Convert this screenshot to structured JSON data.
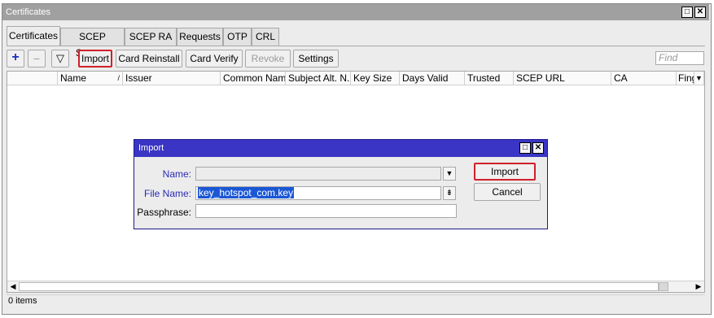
{
  "window": {
    "title": "Certificates",
    "restore_glyph": "□",
    "close_glyph": "✕"
  },
  "tabs": [
    {
      "label": "Certificates",
      "active": true
    },
    {
      "label": "SCEP Servers",
      "active": false
    },
    {
      "label": "SCEP RA",
      "active": false
    },
    {
      "label": "Requests",
      "active": false
    },
    {
      "label": "OTP",
      "active": false
    },
    {
      "label": "CRL",
      "active": false
    }
  ],
  "toolbar": {
    "add_glyph": "+",
    "remove_glyph": "−",
    "filter_glyph": "▽",
    "import_label": "Import",
    "card_reinstall_label": "Card Reinstall",
    "card_verify_label": "Card Verify",
    "revoke_label": "Revoke",
    "settings_label": "Settings",
    "find_placeholder": "Find"
  },
  "table": {
    "columns": [
      "",
      "Name",
      "Issuer",
      "Common Name",
      "Subject Alt. N...",
      "Key Size",
      "Days Valid",
      "Trusted",
      "SCEP URL",
      "CA",
      "Fing"
    ],
    "sort_glyph": "/",
    "more_glyph": "▼",
    "rows": []
  },
  "status": {
    "items_count": "0 items"
  },
  "dialog": {
    "title": "Import",
    "restore_glyph": "□",
    "close_glyph": "✕",
    "name_label": "Name:",
    "name_value": "",
    "file_name_label": "File Name:",
    "file_name_value": "key_hotspot_com.key",
    "passphrase_label": "Passphrase:",
    "passphrase_value": "",
    "import_button": "Import",
    "cancel_button": "Cancel"
  },
  "colors": {
    "dialog_title_bg": "#3a35c4",
    "highlight_border": "#d0202a",
    "selection_bg": "#1a57d6"
  }
}
